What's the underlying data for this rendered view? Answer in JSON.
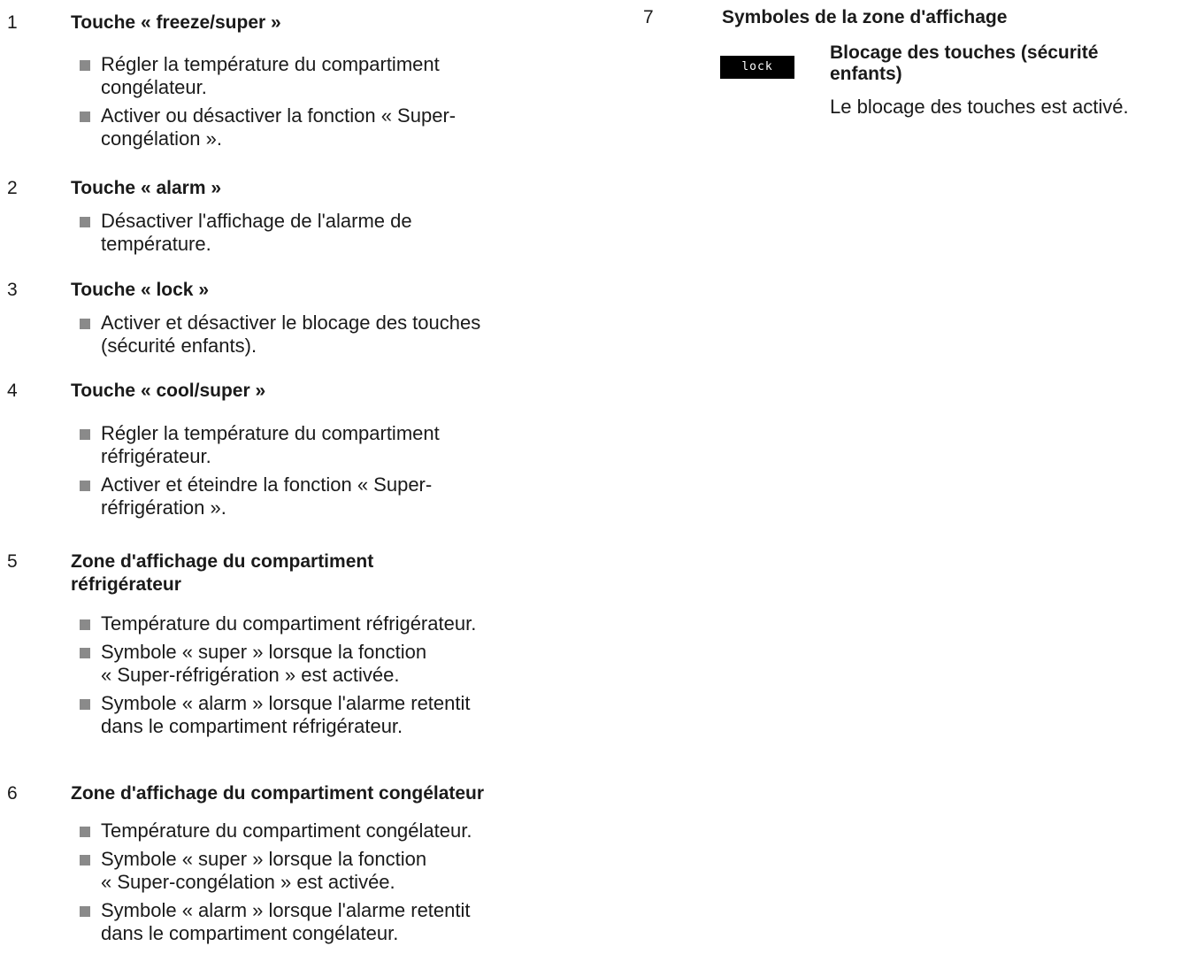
{
  "left_column": {
    "sections": [
      {
        "number": "1",
        "title": "Touche « freeze/super »",
        "items": [
          "Régler la température du compartiment\ncongélateur.",
          "Activer ou désactiver la fonction « Super-\ncongélation »."
        ]
      },
      {
        "number": "2",
        "title": "Touche « alarm »",
        "items": [
          "Désactiver l'affichage de l'alarme de\ntempérature."
        ]
      },
      {
        "number": "3",
        "title": "Touche « lock »",
        "items": [
          "Activer et désactiver le blocage des touches\n(sécurité enfants)."
        ]
      },
      {
        "number": "4",
        "title": "Touche « cool/super »",
        "items": [
          "Régler la température du compartiment\nréfrigérateur.",
          "Activer et éteindre la fonction « Super-\nréfrigération »."
        ]
      },
      {
        "number": "5",
        "title": "Zone d'affichage du compartiment\nréfrigérateur",
        "items": [
          "Température du compartiment réfrigérateur.",
          "Symbole « super » lorsque la fonction\n« Super-réfrigération » est activée.",
          "Symbole « alarm » lorsque l'alarme retentit\ndans le compartiment réfrigérateur."
        ]
      },
      {
        "number": "6",
        "title": "Zone d'affichage du compartiment congélateur",
        "items": [
          "Température du compartiment congélateur.",
          "Symbole « super » lorsque la fonction\n« Super-congélation » est activée.",
          "Symbole « alarm » lorsque l'alarme retentit\ndans le compartiment congélateur."
        ]
      }
    ]
  },
  "right_column": {
    "number": "7",
    "title": "Symboles de la zone d'affichage",
    "symbol": {
      "display_text": "lock",
      "title": "Blocage des touches (sécurité\nenfants)",
      "description": "Le blocage des touches est activé."
    }
  }
}
